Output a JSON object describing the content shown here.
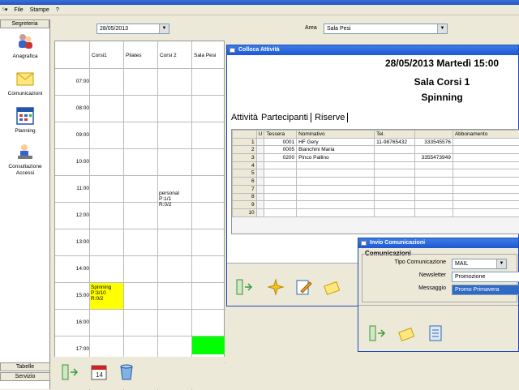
{
  "menu": [
    "File",
    "Stampe",
    "?"
  ],
  "sidebar": {
    "header": "Segreteria",
    "items": [
      "Anagrafica",
      "Comunicazioni",
      "Planning",
      "Consultazione Accessi"
    ],
    "footer": [
      "Tabelle",
      "Servizio"
    ]
  },
  "toolbar": {
    "date": "28/05/2013",
    "area_label": "Area",
    "area_value": "Sala Pesi"
  },
  "grid": {
    "columns": [
      "Corsi1",
      "Pilates",
      "Corsi 2",
      "Sala Pesi"
    ],
    "times": [
      "07:00",
      "08:00",
      "09:00",
      "10:00",
      "11:00",
      "12:00",
      "13:00",
      "14:00",
      "15:00",
      "16:00",
      "17:00"
    ],
    "events": [
      {
        "lines": [
          "personal",
          "P:1/1",
          "R:0/2"
        ]
      },
      {
        "lines": [
          "Spinning",
          "P:3/10",
          "R:0/2"
        ]
      }
    ]
  },
  "colloca": {
    "title": "Colloca Attività",
    "heading1": "28/05/2013 Martedì 15:00",
    "heading2": "Sala Corsi 1",
    "heading3": "Spinning",
    "tabs": [
      "Attività",
      "Partecipanti",
      "Riserve"
    ],
    "table": {
      "headers": [
        "",
        "U",
        "Tessera",
        "Nominativo",
        "Tel.",
        "",
        "Abbonamento"
      ],
      "rows": [
        [
          "1",
          "",
          "0001",
          "HF Gery",
          "11-98765432",
          "333545576",
          ""
        ],
        [
          "2",
          "",
          "0005",
          "Bianchini Maria",
          "",
          "",
          ""
        ],
        [
          "3",
          "",
          "0200",
          "Pinco Pallino",
          "",
          "3355473949",
          ""
        ],
        [
          "4",
          "",
          "",
          "",
          "",
          "",
          ""
        ],
        [
          "5",
          "",
          "",
          "",
          "",
          "",
          ""
        ],
        [
          "6",
          "",
          "",
          "",
          "",
          "",
          ""
        ],
        [
          "7",
          "",
          "",
          "",
          "",
          "",
          ""
        ],
        [
          "8",
          "",
          "",
          "",
          "",
          "",
          ""
        ],
        [
          "9",
          "",
          "",
          "",
          "",
          "",
          ""
        ],
        [
          "10",
          "",
          "",
          "",
          "",
          "",
          ""
        ]
      ]
    }
  },
  "invio": {
    "title": "Invio Comunicazioni",
    "section": "Comunicazioni",
    "tipo_label": "Tipo Comunicazione",
    "tipo_value": "MAIL",
    "newsletter_label": "Newsletter",
    "newsletter_value": "Promozione",
    "messaggio_label": "Messaggio",
    "messaggio_value": "Promo Primavera"
  },
  "colors": {
    "title_bar": "#1f57d0",
    "event_yellow": "#ffff00",
    "event_green": "#00ff00",
    "selection": "#316ac5"
  }
}
